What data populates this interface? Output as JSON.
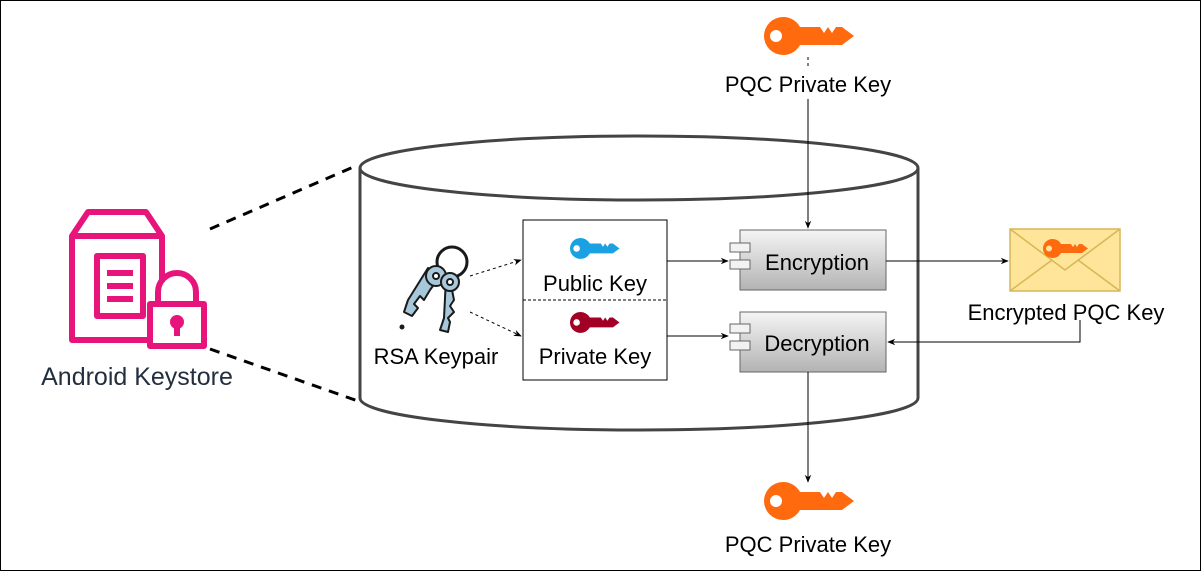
{
  "labels": {
    "pqc_private_key_top": "PQC Private Key",
    "pqc_private_key_bottom": "PQC Private Key",
    "android_keystore": "Android Keystore",
    "rsa_keypair": "RSA Keypair",
    "public_key": "Public Key",
    "private_key": "Private Key",
    "encryption": "Encryption",
    "decryption": "Decryption",
    "encrypted_pqc_key": "Encrypted PQC Key"
  },
  "colors": {
    "keystore_icon": "#E7157B",
    "pqc_key": "#FF6A0E",
    "public_key": "#1BA1E2",
    "private_key": "#A20025",
    "envelope_fill": "#FFE599",
    "envelope_stroke": "#D6B656",
    "component_stroke": "#666666"
  },
  "icons": {
    "keystore": "keystore-lock-icon",
    "rsa_keypair": "key-ring-icon",
    "public_key": "key-icon",
    "private_key": "key-icon",
    "pqc_key": "key-icon",
    "envelope": "envelope-icon",
    "component": "component-icon"
  }
}
